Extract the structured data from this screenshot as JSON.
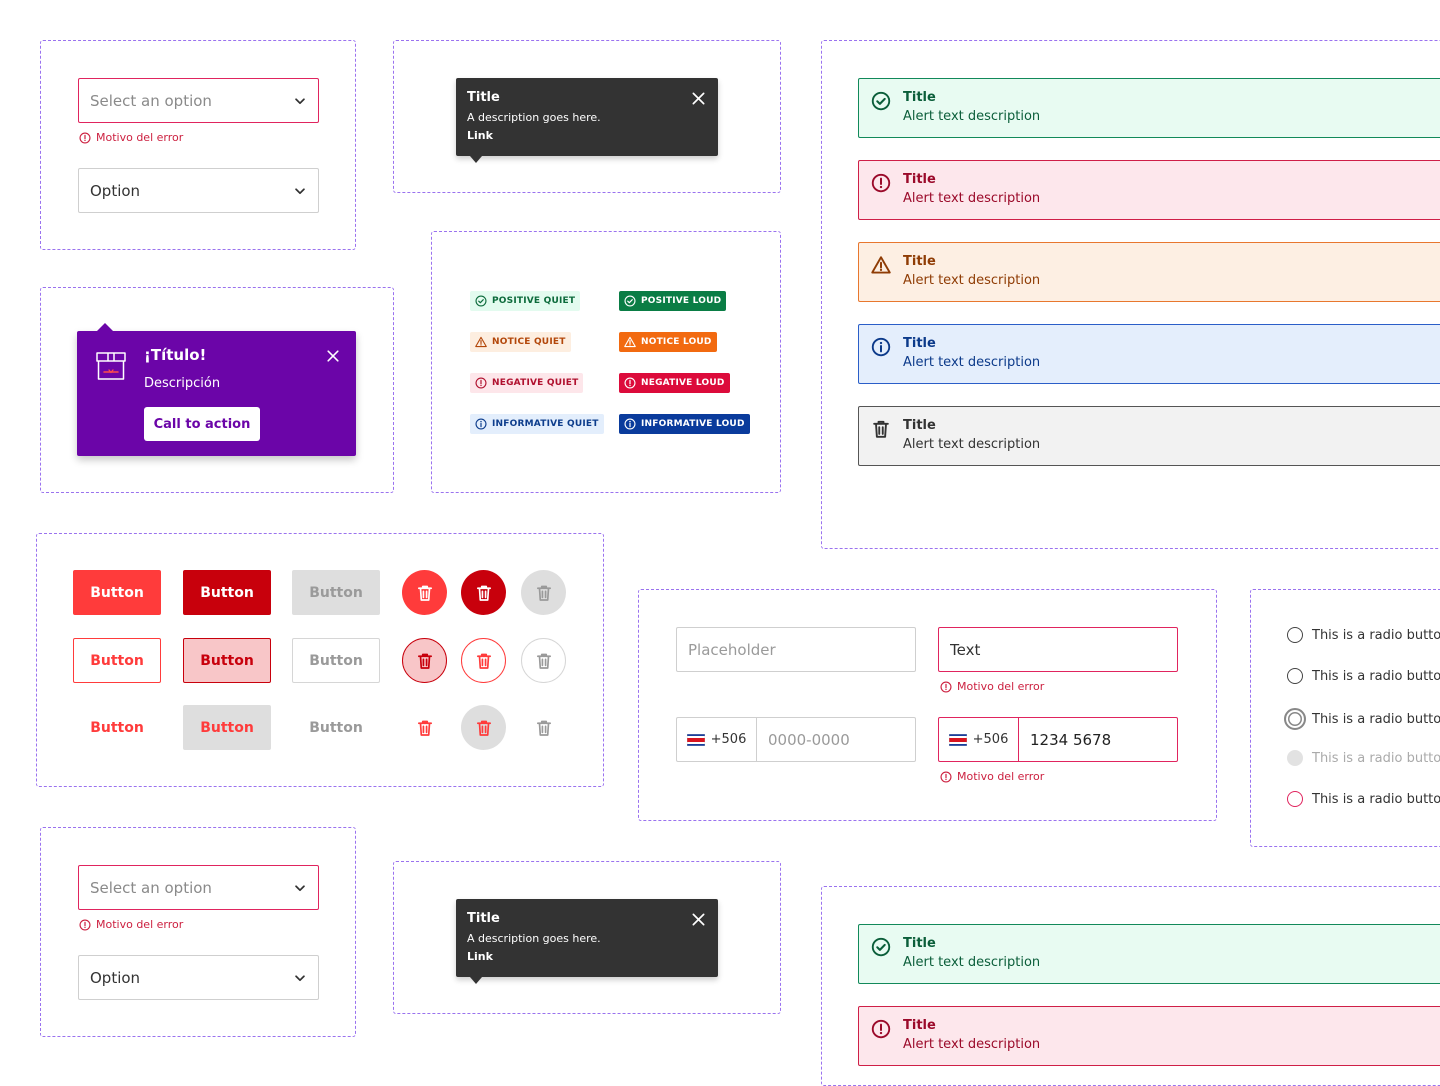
{
  "colors": {
    "frame_border": "#9a72ef",
    "error": "#e0245e",
    "purple": "#6b05a8",
    "tooltip_bg": "#333333",
    "red_primary": "#ff3b3b",
    "red_dark": "#c8000c"
  },
  "select_group_1": {
    "error_select": {
      "placeholder": "Select an option",
      "icon": "chevron-down-icon"
    },
    "error_message": "Motivo del error",
    "normal_select": {
      "value": "Option",
      "icon": "chevron-down-icon"
    }
  },
  "select_group_2": {
    "error_select": {
      "placeholder": "Select an option",
      "icon": "chevron-down-icon"
    },
    "error_message": "Motivo del error",
    "normal_select": {
      "value": "Option",
      "icon": "chevron-down-icon"
    }
  },
  "tooltip_1": {
    "title": "Title",
    "description": "A description goes here.",
    "link": "Link",
    "close_icon": "close-icon"
  },
  "tooltip_2": {
    "title": "Title",
    "description": "A description goes here.",
    "link": "Link",
    "close_icon": "close-icon"
  },
  "popover": {
    "title": "¡Título!",
    "description": "Descripción",
    "cta": "Call to action",
    "icon": "package-icon",
    "close_icon": "close-icon"
  },
  "badges": [
    {
      "label": "POSITIVE QUIET",
      "icon": "check-circle-icon"
    },
    {
      "label": "POSITIVE LOUD",
      "icon": "check-circle-icon"
    },
    {
      "label": "NOTICE QUIET",
      "icon": "warning-icon"
    },
    {
      "label": "NOTICE LOUD",
      "icon": "warning-icon"
    },
    {
      "label": "NEGATIVE QUIET",
      "icon": "error-icon"
    },
    {
      "label": "NEGATIVE LOUD",
      "icon": "error-icon"
    },
    {
      "label": "INFORMATIVE QUIET",
      "icon": "info-icon"
    },
    {
      "label": "INFORMATIVE LOUD",
      "icon": "info-icon"
    }
  ],
  "alerts": [
    {
      "title": "Title",
      "description": "Alert text description",
      "variant": "success",
      "icon": "check-circle-icon"
    },
    {
      "title": "Title",
      "description": "Alert text description",
      "variant": "error",
      "icon": "error-icon"
    },
    {
      "title": "Title",
      "description": "Alert text description",
      "variant": "warning",
      "icon": "warning-icon"
    },
    {
      "title": "Title",
      "description": "Alert text description",
      "variant": "info",
      "icon": "info-icon"
    },
    {
      "title": "Title",
      "description": "Alert text description",
      "variant": "neutral",
      "icon": "trash-icon"
    }
  ],
  "alerts_bottom": [
    {
      "title": "Title",
      "description": "Alert text description",
      "variant": "success",
      "icon": "check-circle-icon"
    },
    {
      "title": "Title",
      "description": "Alert text description",
      "variant": "error",
      "icon": "error-icon"
    }
  ],
  "buttons": {
    "label": "Button",
    "icon": "trash-icon"
  },
  "inputs": {
    "placeholder": "Placeholder",
    "text_value": "Text",
    "error_message": "Motivo del error",
    "phone_prefix": "+506",
    "phone_placeholder": "0000-0000",
    "phone_value": "1234 5678",
    "phone_error_message": "Motivo del error",
    "flag_icon": "costa-rica-flag-icon"
  },
  "radios": [
    {
      "label": "This is a radio button",
      "state": "default"
    },
    {
      "label": "This is a radio button",
      "state": "default"
    },
    {
      "label": "This is a radio button",
      "state": "focused"
    },
    {
      "label": "This is a radio button",
      "state": "disabled"
    },
    {
      "label": "This is a radio button",
      "state": "error"
    }
  ]
}
